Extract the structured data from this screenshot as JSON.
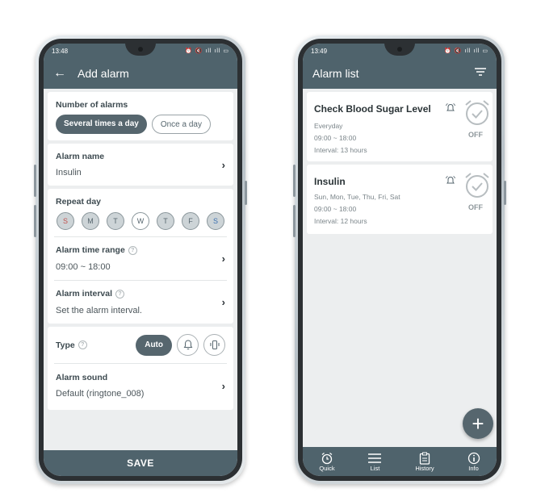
{
  "left": {
    "status": {
      "time": "13:48",
      "icons": "⏰ 🔇 ıll ıll ▭"
    },
    "appbar": {
      "title": "Add alarm"
    },
    "number_of_alarms": {
      "label": "Number of alarms",
      "options": [
        "Several times a day",
        "Once a day"
      ],
      "selected": "Several times a day"
    },
    "alarm_name": {
      "label": "Alarm name",
      "value": "Insulin"
    },
    "repeat_day": {
      "label": "Repeat day",
      "days": [
        {
          "letter": "S",
          "selected": true,
          "color": "#c0504d"
        },
        {
          "letter": "M",
          "selected": true,
          "color": "#56666e"
        },
        {
          "letter": "T",
          "selected": true,
          "color": "#56666e"
        },
        {
          "letter": "W",
          "selected": false,
          "color": "#56666e"
        },
        {
          "letter": "T",
          "selected": true,
          "color": "#56666e"
        },
        {
          "letter": "F",
          "selected": true,
          "color": "#56666e"
        },
        {
          "letter": "S",
          "selected": true,
          "color": "#3a6fb0"
        }
      ]
    },
    "time_range": {
      "label": "Alarm time range",
      "value": "09:00 ~ 18:00"
    },
    "interval": {
      "label": "Alarm interval",
      "value": "Set the alarm interval."
    },
    "type": {
      "label": "Type",
      "auto_label": "Auto"
    },
    "sound": {
      "label": "Alarm sound",
      "value": "Default (ringtone_008)"
    },
    "save_label": "SAVE"
  },
  "right": {
    "status": {
      "time": "13:49",
      "icons": "⏰ 🔇 ıll ıll ▭"
    },
    "appbar": {
      "title": "Alarm list"
    },
    "alarms": [
      {
        "title": "Check Blood Sugar Level",
        "days": "Everyday",
        "time": "09:00 ~ 18:00",
        "interval": "Interval: 13 hours",
        "state": "OFF"
      },
      {
        "title": "Insulin",
        "days": "Sun, Mon, Tue, Thu, Fri, Sat",
        "time": "09:00 ~ 18:00",
        "interval": "Interval: 12 hours",
        "state": "OFF"
      }
    ],
    "fab_label": "+",
    "nav": [
      {
        "label": "Quick",
        "icon": "alarm-clock-icon"
      },
      {
        "label": "List",
        "icon": "list-icon"
      },
      {
        "label": "History",
        "icon": "clipboard-icon"
      },
      {
        "label": "Info",
        "icon": "info-icon"
      }
    ]
  },
  "colors": {
    "primary": "#4f636c",
    "accent": "#56666e",
    "background": "#eceeef"
  }
}
